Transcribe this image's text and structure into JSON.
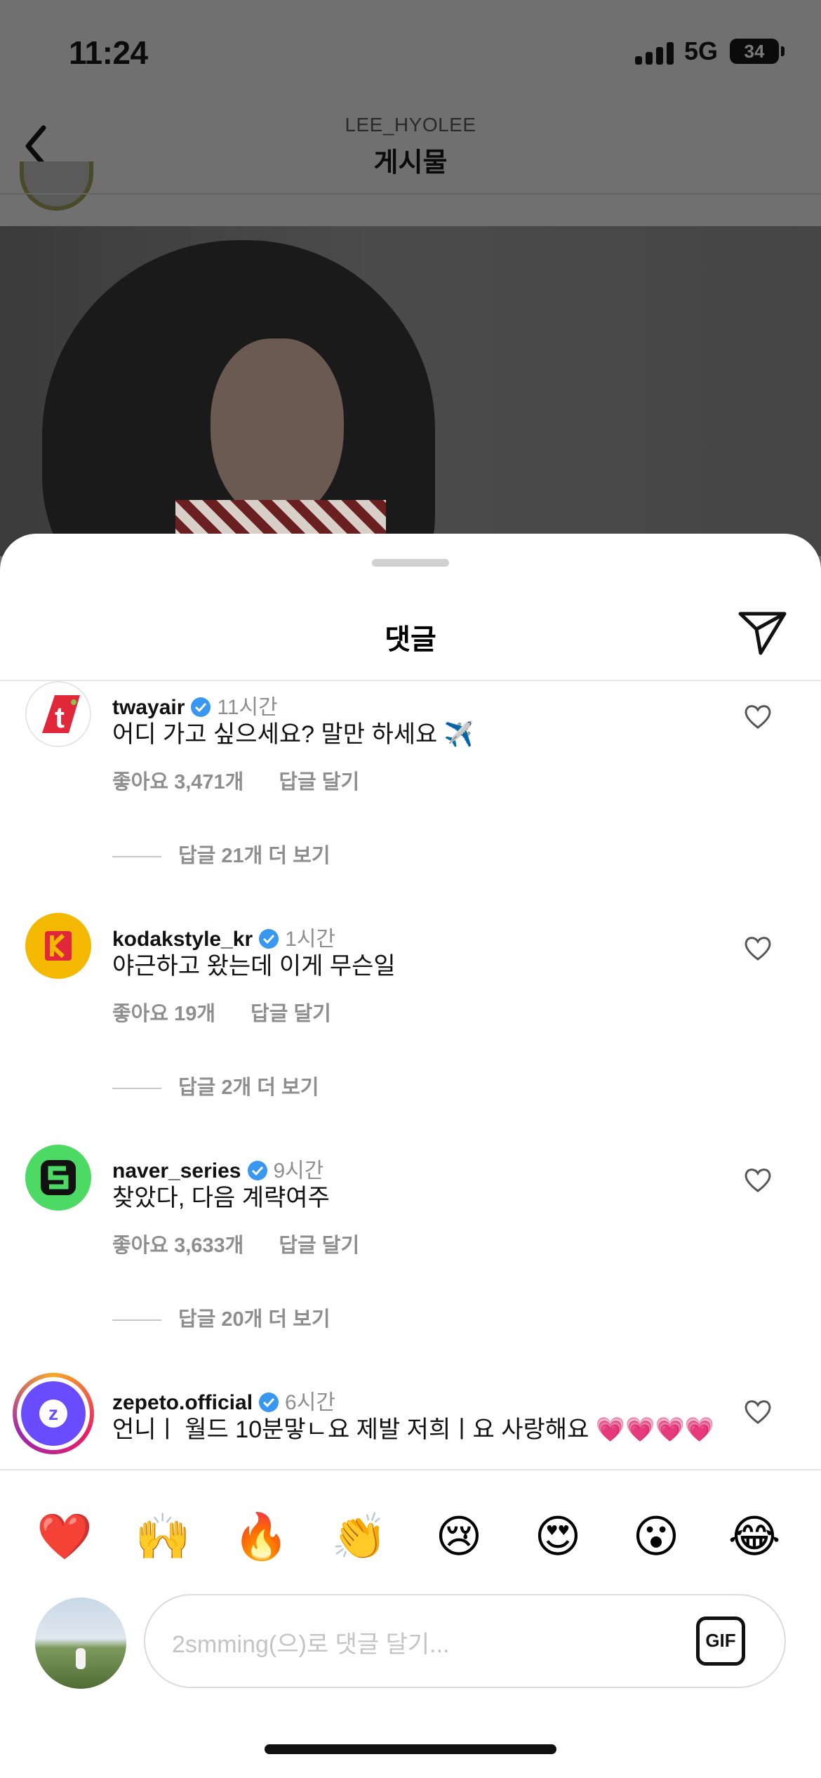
{
  "status_bar": {
    "time": "11:24",
    "network": "5G",
    "battery": "34"
  },
  "post_header": {
    "account": "LEE_HYOLEE",
    "title": "게시물"
  },
  "sheet": {
    "title": "댓글"
  },
  "comments": [
    {
      "username": "twayair",
      "time": "11시간",
      "text": "어디 가고 싶으세요? 말만 하세요 ✈️",
      "likes": "좋아요 3,471개",
      "reply_label": "답글 달기",
      "more_replies": "답글 21개 더 보기",
      "avatar_icon": "tway-logo-icon"
    },
    {
      "username": "kodakstyle_kr",
      "time": "1시간",
      "text": "야근하고 왔는데 이게 무슨일",
      "likes": "좋아요 19개",
      "reply_label": "답글 달기",
      "more_replies": "답글 2개 더 보기",
      "avatar_icon": "kodak-logo-icon"
    },
    {
      "username": "naver_series",
      "time": "9시간",
      "text": "찾았다, 다음 계략여주",
      "likes": "좋아요 3,633개",
      "reply_label": "답글 달기",
      "more_replies": "답글 20개 더 보기",
      "avatar_icon": "naver-series-logo-icon"
    },
    {
      "username": "zepeto.official",
      "time": "6시간",
      "text": "언니ㅣ 월드 10분맣ㄴ요 제발 저희ㅣ요 사랑해요 💗💗💗💗",
      "avatar_icon": "zepeto-logo-icon"
    }
  ],
  "quick_reactions": [
    "❤️",
    "🙌",
    "🔥",
    "👏",
    "😢",
    "😍",
    "😮",
    "😂"
  ],
  "composer": {
    "placeholder": "2smming(으)로 댓글 달기...",
    "gif_label": "GIF"
  },
  "colors": {
    "verified": "#3897f0",
    "secondary_text": "#8e8e8e",
    "tway_red": "#e0283a",
    "kodak_yellow": "#f5b800",
    "naver_green": "#4cd964",
    "zepeto_purple": "#6a4cff"
  }
}
